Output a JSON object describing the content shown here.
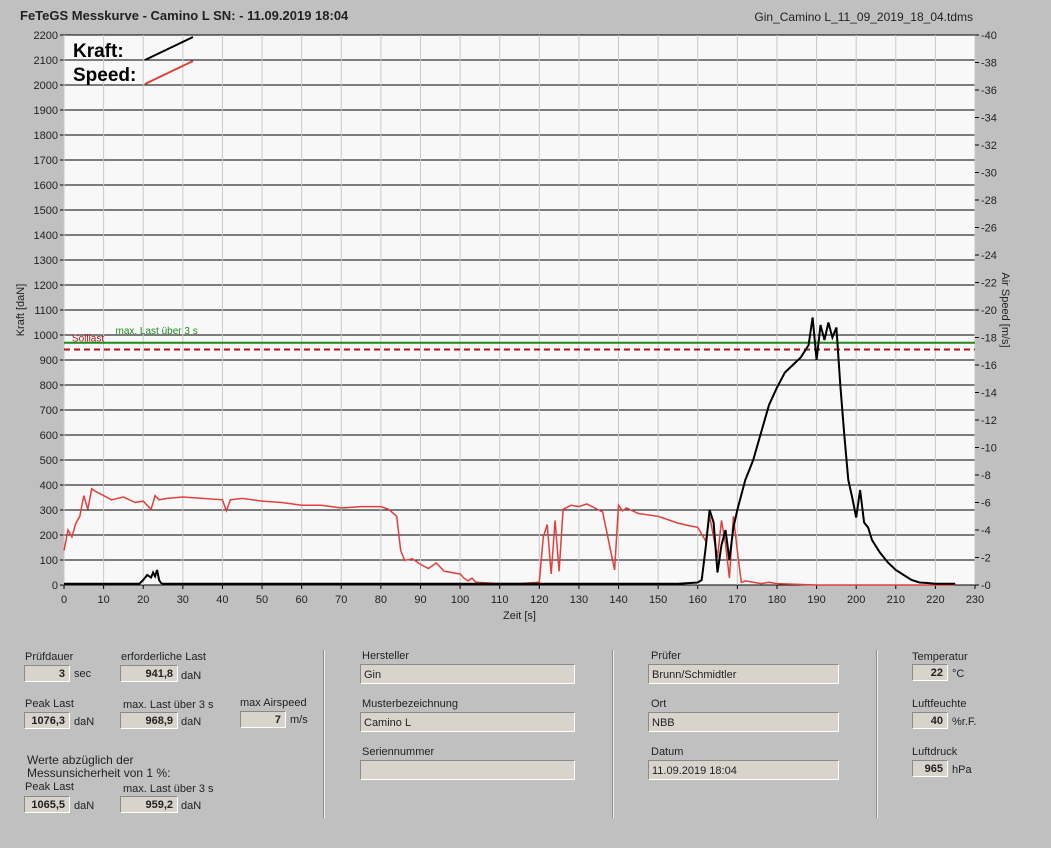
{
  "header": {
    "title": "FeTeGS Messkurve - Camino L  SN:  - 11.09.2019 18:04",
    "filename": "Gin_Camino L_11_09_2019_18_04.tdms"
  },
  "colors": {
    "kraft": "#000000",
    "speed": "#e0403c",
    "max_last_line": "#1e8a1e",
    "soll_line": "#b0141a",
    "plot_bg": "#f8f8f8",
    "grid": "#000000"
  },
  "chart_data": {
    "type": "line",
    "xlabel": "Zeit [s]",
    "ylabel": "Kraft [daN]",
    "y2label": "Air Speed [m/s]",
    "xlim": [
      0,
      230
    ],
    "ylim": [
      0,
      2200
    ],
    "y2lim": [
      0,
      40
    ],
    "x_ticks": [
      0,
      10,
      20,
      30,
      40,
      50,
      60,
      70,
      80,
      90,
      100,
      110,
      120,
      130,
      140,
      150,
      160,
      170,
      180,
      190,
      200,
      210,
      220,
      230
    ],
    "y_ticks": [
      0,
      100,
      200,
      300,
      400,
      500,
      600,
      700,
      800,
      900,
      1000,
      1100,
      1200,
      1300,
      1400,
      1500,
      1600,
      1700,
      1800,
      1900,
      2000,
      2100,
      2200
    ],
    "y2_ticks": [
      0,
      2,
      4,
      6,
      8,
      10,
      12,
      14,
      16,
      18,
      20,
      22,
      24,
      26,
      28,
      30,
      32,
      34,
      36,
      38,
      40
    ],
    "grid": true,
    "legend": [
      {
        "label": "Kraft:",
        "color": "#000000"
      },
      {
        "label": "Speed:",
        "color": "#e0403c"
      }
    ],
    "annotations": [
      {
        "text": "max. Last über  3 s",
        "value": 968.9
      },
      {
        "text": "Solllast",
        "value": 941.8
      }
    ],
    "series": [
      {
        "name": "Kraft",
        "axis": "left",
        "x": [
          0,
          19,
          20,
          21,
          22,
          22.5,
          23,
          23.5,
          24,
          24.5,
          25,
          60,
          120,
          155,
          160,
          161,
          162,
          163,
          164,
          165,
          166,
          167,
          168,
          169,
          170,
          172,
          174,
          176,
          178,
          180,
          182,
          184,
          186,
          188,
          189,
          190,
          191,
          192,
          193,
          194,
          195,
          196,
          197,
          198,
          199,
          200,
          201,
          202,
          203,
          204,
          206,
          208,
          210,
          212,
          214,
          216,
          218,
          220,
          225
        ],
        "values": [
          5,
          5,
          20,
          40,
          30,
          50,
          35,
          60,
          20,
          8,
          5,
          5,
          5,
          5,
          10,
          20,
          150,
          300,
          250,
          50,
          160,
          220,
          100,
          230,
          300,
          420,
          500,
          610,
          720,
          790,
          850,
          880,
          910,
          960,
          1070,
          900,
          1040,
          980,
          1050,
          990,
          1030,
          800,
          600,
          420,
          350,
          270,
          380,
          250,
          230,
          180,
          130,
          90,
          60,
          40,
          20,
          10,
          8,
          5,
          5
        ]
      },
      {
        "name": "Speed",
        "axis": "right",
        "x": [
          0,
          1,
          2,
          3,
          4,
          5,
          6,
          7,
          8,
          10,
          12,
          15,
          18,
          20,
          22,
          23,
          24,
          26,
          30,
          35,
          40,
          41,
          42,
          45,
          50,
          55,
          60,
          65,
          70,
          75,
          80,
          82,
          84,
          85,
          86,
          88,
          90,
          92,
          94,
          96,
          98,
          100,
          101,
          102,
          103,
          104,
          110,
          115,
          120,
          121,
          122,
          123,
          124,
          125,
          126,
          128,
          130,
          132,
          134,
          136,
          138,
          139,
          140,
          141,
          142,
          145,
          150,
          152,
          155,
          158,
          160,
          162,
          163,
          164,
          165,
          166,
          167,
          168,
          169,
          170,
          171,
          172,
          174,
          176,
          178,
          180,
          190,
          200,
          210,
          225
        ],
        "values": [
          2.5,
          4,
          3.5,
          4.5,
          5,
          6.5,
          5.5,
          7,
          6.8,
          6.5,
          6.2,
          6.4,
          6,
          6.1,
          5.5,
          6.5,
          6.2,
          6.3,
          6.4,
          6.3,
          6.2,
          5.4,
          6.2,
          6.3,
          6.1,
          6,
          5.8,
          5.8,
          5.6,
          5.7,
          5.7,
          5.5,
          5,
          2.5,
          1.8,
          1.9,
          1.5,
          1.2,
          1.6,
          1.0,
          0.9,
          0.8,
          0.5,
          0.3,
          0.5,
          0.2,
          0.1,
          0.1,
          0.2,
          3.5,
          4.4,
          0.8,
          4.7,
          1,
          5.5,
          5.8,
          5.7,
          5.9,
          5.6,
          5.3,
          2.5,
          1.1,
          5.8,
          5.4,
          5.6,
          5.2,
          5,
          4.8,
          4.5,
          4.3,
          4.2,
          3.2,
          5,
          3.5,
          2,
          4.7,
          3,
          0.5,
          5,
          2.5,
          0.2,
          0.3,
          0.2,
          0.1,
          0.2,
          0.1,
          0,
          0,
          0,
          0
        ]
      }
    ]
  },
  "fields": {
    "pruefdauer": {
      "label": "Prüfdauer",
      "value": "3",
      "unit": "sec"
    },
    "erf_last": {
      "label": "erforderliche Last",
      "value": "941,8",
      "unit": "daN"
    },
    "peak_last": {
      "label": "Peak Last",
      "value": "1076,3",
      "unit": "daN"
    },
    "max_last": {
      "label": "max. Last über  3 s",
      "value": "968,9",
      "unit": "daN"
    },
    "max_airspeed": {
      "label": "max Airspeed",
      "value": "7",
      "unit": "m/s"
    },
    "werte_note": "Werte abzüglich der\nMessunsicherheit von 1  %:",
    "peak_last2": {
      "label": "Peak Last",
      "value": "1065,5",
      "unit": "daN"
    },
    "max_last2": {
      "label": "max. Last über  3 s",
      "value": "959,2",
      "unit": "daN"
    },
    "hersteller": {
      "label": "Hersteller",
      "value": "Gin"
    },
    "muster": {
      "label": "Musterbezeichnung",
      "value": "Camino L"
    },
    "serien": {
      "label": "Seriennummer",
      "value": ""
    },
    "pruefer": {
      "label": "Prüfer",
      "value": "Brunn/Schmidtler"
    },
    "ort": {
      "label": "Ort",
      "value": "NBB"
    },
    "datum": {
      "label": "Datum",
      "value": "11.09.2019 18:04"
    },
    "temperatur": {
      "label": "Temperatur",
      "value": "22",
      "unit": "°C"
    },
    "luftfeuchte": {
      "label": "Luftfeuchte",
      "value": "40",
      "unit": "%r.F."
    },
    "luftdruck": {
      "label": "Luftdruck",
      "value": "965",
      "unit": "hPa"
    }
  }
}
